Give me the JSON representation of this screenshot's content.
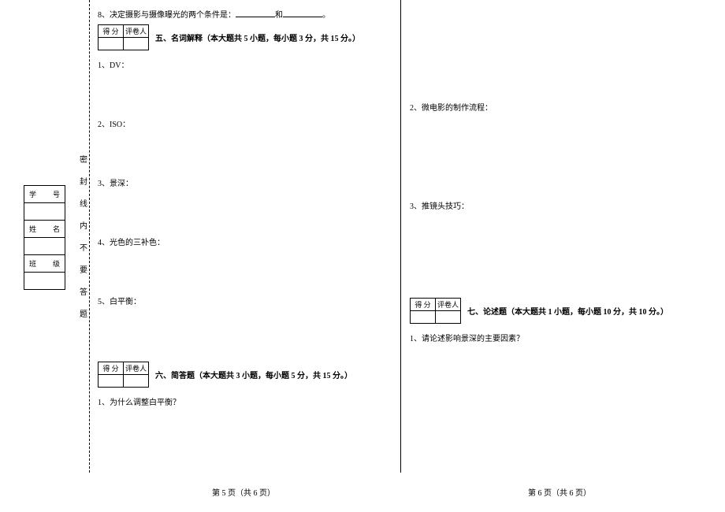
{
  "info_labels": {
    "student_id": "学　号",
    "name": "姓　名",
    "class": "班　级"
  },
  "seal_text": "密封线内不要答题",
  "q8": {
    "prefix": "8、决定摄影与摄像曝光的两个条件是：",
    "mid": "和",
    "suffix": "。"
  },
  "score_headers": {
    "score": "得 分",
    "reviewer": "评卷人"
  },
  "sections": {
    "s5": "五、名词解释（本大题共 5 小题，每小题 3 分，共 15 分。）",
    "s6": "六、简答题（本大题共 3 小题，每小题 5 分，共 15 分。）",
    "s7": "七、论述题（本大题共 1 小题，每小题 10 分，共 10 分。）"
  },
  "terms": {
    "t1": "1、DV：",
    "t2": "2、ISO：",
    "t3": "3、景深：",
    "t4": "4、光色的三补色：",
    "t5": "5、白平衡："
  },
  "short_answers": {
    "a1": "1、为什么调整白平衡？",
    "a2": "2、微电影的制作流程：",
    "a3": "3、推镜头技巧："
  },
  "essay": {
    "q1": "1、请论述影响景深的主要因素？"
  },
  "footers": {
    "p5": "第 5 页（共 6 页）",
    "p6": "第 6 页（共 6 页）"
  }
}
